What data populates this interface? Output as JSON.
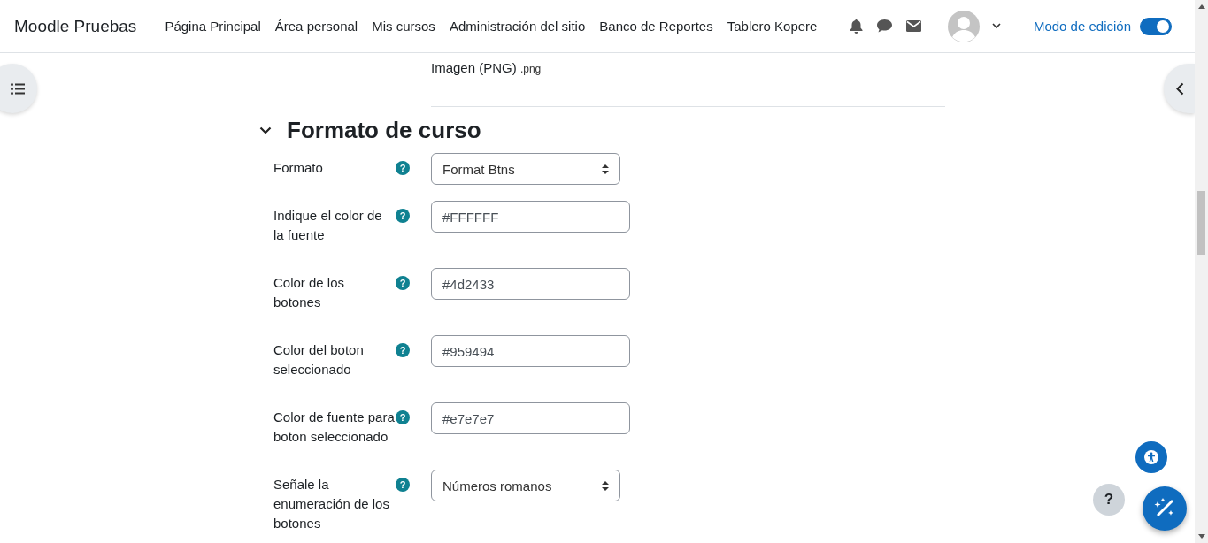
{
  "header": {
    "brand": "Moodle Pruebas",
    "nav": [
      {
        "label": "Página Principal"
      },
      {
        "label": "Área personal"
      },
      {
        "label": "Mis cursos"
      },
      {
        "label": "Administración del sitio"
      },
      {
        "label": "Banco de Reportes"
      },
      {
        "label": "Tablero Kopere"
      }
    ],
    "edit_mode": {
      "label": "Modo de edición",
      "on": true
    }
  },
  "file_type": {
    "name": "Imagen (PNG)",
    "ext": ".png"
  },
  "section": {
    "title": "Formato de curso",
    "expanded": true
  },
  "fields": [
    {
      "label_lines": [
        "Formato"
      ],
      "help": "?",
      "kind": "select",
      "value": "Format Btns"
    },
    {
      "label_lines": [
        "Indique el color de",
        "la fuente"
      ],
      "help": "?",
      "kind": "text",
      "value": "#FFFFFF"
    },
    {
      "label_lines": [
        "Color de los",
        "botones"
      ],
      "help": "?",
      "kind": "text",
      "value": "#4d2433"
    },
    {
      "label_lines": [
        "Color del boton",
        "seleccionado"
      ],
      "help": "?",
      "kind": "text",
      "value": "#959494"
    },
    {
      "label_lines": [
        "Color de fuente para",
        "boton seleccionado"
      ],
      "help": "?",
      "kind": "text",
      "value": "#e7e7e7"
    },
    {
      "label_lines": [
        "Señale la",
        "enumeración de los",
        "botones"
      ],
      "help": "?",
      "kind": "select",
      "value": "Números romanos"
    }
  ],
  "help_button": "?"
}
